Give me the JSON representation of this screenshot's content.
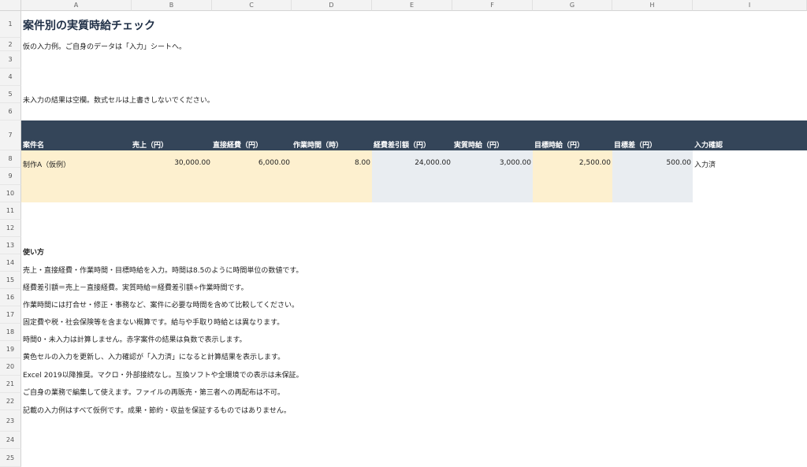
{
  "columns": [
    "A",
    "B",
    "C",
    "D",
    "E",
    "F",
    "G",
    "H",
    "I"
  ],
  "rows": [
    "1",
    "2",
    "3",
    "4",
    "5",
    "6",
    "7",
    "8",
    "9",
    "10",
    "11",
    "12",
    "13",
    "14",
    "15",
    "16",
    "17",
    "18",
    "19",
    "20",
    "21",
    "22",
    "23",
    "24",
    "25"
  ],
  "title": "案件別の実質時給チェック",
  "note1": "仮の入力例。ご自身のデータは「入力」シートへ。",
  "note2": "未入力の結果は空欄。数式セルは上書きしないでください。",
  "table": {
    "headers": [
      "案件名",
      "売上（円）",
      "直接経費（円）",
      "作業時間（時）",
      "経費差引額（円）",
      "実質時給（円）",
      "目標時給（円）",
      "目標差（円）",
      "入力確認"
    ],
    "row": [
      "制作A（仮例）",
      "30,000.00",
      "6,000.00",
      "8.00",
      "24,000.00",
      "3,000.00",
      "2,500.00",
      "500.00",
      "入力済"
    ]
  },
  "howto": {
    "heading": "使い方",
    "lines": [
      "売上・直接経費・作業時間・目標時給を入力。時間は8.5のように時間単位の数値です。",
      "経費差引額＝売上－直接経費。実質時給＝経費差引額÷作業時間です。",
      "作業時間には打合せ・修正・事務など、案件に必要な時間を含めて比較してください。",
      "固定費や税・社会保険等を含まない概算です。給与や手取り時給とは異なります。",
      "時間0・未入力は計算しません。赤字案件の結果は負数で表示します。",
      "黄色セルの入力を更新し、入力確認が「入力済」になると計算結果を表示します。",
      "Excel 2019以降推奨。マクロ・外部接続なし。互換ソフトや全環境での表示は未保証。",
      "ご自身の業務で編集して使えます。ファイルの再販売・第三者への再配布は不可。",
      "記載の入力例はすべて仮例です。成果・節約・収益を保証するものではありません。"
    ]
  },
  "colors": {
    "header_bg": "#344559",
    "input_fill": "#fdf0cf",
    "calc_fill": "#e9edf1"
  }
}
